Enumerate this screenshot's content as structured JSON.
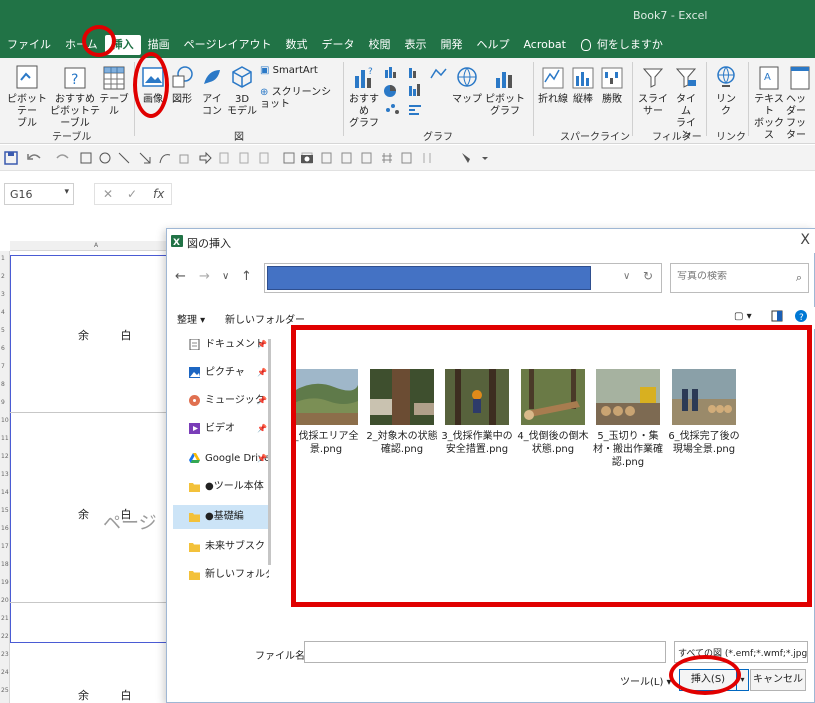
{
  "window": {
    "title": "Book7 - Excel"
  },
  "ribbon_tabs": [
    {
      "label": "ファイル"
    },
    {
      "label": "ホーム"
    },
    {
      "label": "挿入",
      "active": true
    },
    {
      "label": "描画"
    },
    {
      "label": "ページレイアウト"
    },
    {
      "label": "数式"
    },
    {
      "label": "データ"
    },
    {
      "label": "校閲"
    },
    {
      "label": "表示"
    },
    {
      "label": "開発"
    },
    {
      "label": "ヘルプ"
    },
    {
      "label": "Acrobat"
    }
  ],
  "tell_me": "何をしますか",
  "ribbon": {
    "pivottable": [
      "ピボットテー",
      "ブル"
    ],
    "recommended_pivot": [
      "おすすめ",
      "ピボットテーブル"
    ],
    "table": "テーブル",
    "group_table": "テーブル",
    "picture": "画像",
    "shapes": "図形",
    "icons": [
      "アイ",
      "コン"
    ],
    "models_3d": [
      "3D",
      "モデル"
    ],
    "smartart": "SmartArt",
    "screenshot": "スクリーンショット",
    "group_illustrations": "図",
    "recommended_charts": [
      "おすすめ",
      "グラフ"
    ],
    "maps": "マップ",
    "pivotchart": "ピボットグラフ",
    "group_charts": "グラフ",
    "line": "折れ線",
    "column": "縦棒",
    "winloss": "勝敗",
    "group_sparklines": "スパークライン",
    "slicer": "スライサー",
    "timeline": [
      "タイム",
      "ライン"
    ],
    "group_filters": "フィルター",
    "link": [
      "リン",
      "ク"
    ],
    "group_links": "リンク",
    "textbox": [
      "テキスト",
      "ボックス"
    ],
    "header_footer": [
      "ヘッダー",
      "フッター"
    ]
  },
  "name_box": "G16",
  "formula_fx": "fx",
  "sheet": {
    "column_label": "A",
    "row_labels": [
      "1",
      "2",
      "3",
      "4",
      "5",
      "6",
      "7",
      "8",
      "9",
      "10",
      "11",
      "12",
      "13",
      "14",
      "15",
      "16",
      "17",
      "18",
      "19",
      "20",
      "21",
      "22",
      "23",
      "24",
      "25"
    ],
    "margin_texts": [
      "余 白",
      "余 白",
      "余 白"
    ],
    "page_watermark": "ページ"
  },
  "dialog": {
    "title": "図の挿入",
    "close": "X",
    "search_placeholder": "写真の検索",
    "organize": "整理",
    "new_folder": "新しいフォルダー",
    "nav_items": [
      {
        "label": "ドキュメント",
        "icon": "documents-icon",
        "pinned": true
      },
      {
        "label": "ピクチャ",
        "icon": "pictures-icon",
        "pinned": true
      },
      {
        "label": "ミュージック",
        "icon": "music-icon",
        "pinned": true
      },
      {
        "label": "ビデオ",
        "icon": "video-icon",
        "pinned": true
      },
      {
        "label": "Google Drive",
        "icon": "google-drive-icon",
        "pinned": true
      },
      {
        "label": "●ツール本体",
        "icon": "folder-icon",
        "pinned": false
      },
      {
        "label": "●基礎編",
        "icon": "folder-icon",
        "pinned": false,
        "selected": true
      },
      {
        "label": "未来サブスク",
        "icon": "folder-icon",
        "pinned": false
      },
      {
        "label": "新しいフォルダー",
        "icon": "folder-icon",
        "pinned": false
      }
    ],
    "files": [
      {
        "name": "_伐採エリア全景.png"
      },
      {
        "name": "2_対象木の状態確認.png"
      },
      {
        "name": "3_伐採作業中の安全措置.png"
      },
      {
        "name": "4_伐倒後の倒木状態.png"
      },
      {
        "name": "5_玉切り・集材・搬出作業確認.png"
      },
      {
        "name": "6_伐採完了後の現場全景.png"
      }
    ],
    "filename_label": "ファイル名(N):",
    "filename_value": "",
    "filetype": "すべての図 (*.emf;*.wmf;*.jpg;*.jj",
    "tools": "ツール(L)",
    "insert": "挿入(S)",
    "cancel": "キャンセル"
  },
  "colors": {
    "excel_green": "#217346",
    "highlight_red": "#e00000",
    "address_blue": "#4472c4",
    "selection_blue": "#cce4f7"
  }
}
